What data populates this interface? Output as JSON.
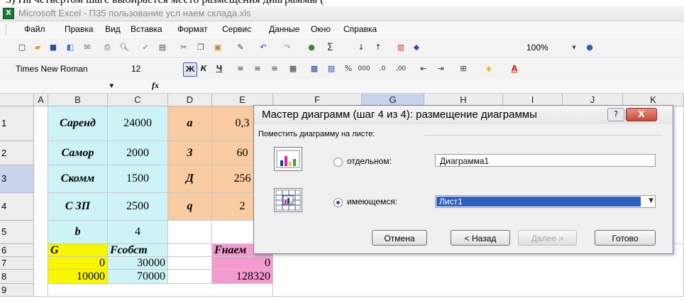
{
  "caption": "5)     На четвертом шаге выбирается место размещения диаграммы (",
  "window": {
    "title": "Microsoft Excel - П35 пользование усл наем склада.xls",
    "app_icon": "excel-icon"
  },
  "menu": [
    "Файл",
    "Правка",
    "Вид",
    "Вставка",
    "Формат",
    "Сервис",
    "Данные",
    "Окно",
    "Справка"
  ],
  "toolbar": {
    "zoom": "100%"
  },
  "format_bar": {
    "font": "Times New Roman",
    "size": "12"
  },
  "formula_bar": {
    "fx": "fx"
  },
  "columns": [
    "A",
    "B",
    "C",
    "D",
    "E",
    "F",
    "G",
    "H",
    "I",
    "J",
    "K"
  ],
  "rows": [
    "1",
    "2",
    "3",
    "4",
    "5",
    "6",
    "7",
    "8",
    "9"
  ],
  "cells": {
    "B1": "Саренд",
    "C1": "24000",
    "D1": "а",
    "E1": "0,3",
    "B2": "Самор",
    "C2": "2000",
    "D2": "З",
    "E2": "60",
    "B3": "Скомм",
    "C3": "1500",
    "D3": "Д",
    "E3": "256",
    "B4": "С ЗП",
    "C4": "2500",
    "D4": "q",
    "E4": "2",
    "B5": "b",
    "C5": "4",
    "B6": "G",
    "C6": "Fсобст",
    "E6": "Fнаем",
    "B7": "0",
    "C7": "30000",
    "E7": "0",
    "B8": "10000",
    "C8": "70000",
    "E8": "128320"
  },
  "dialog": {
    "title": "Мастер диаграмм (шаг 4 из 4): размещение диаграммы",
    "help": "?",
    "close": "X",
    "group_label": "Поместить диаграмму на листе:",
    "option1_label": "отдельном:",
    "option1_value": "Диаграмма1",
    "option2_label": "имеющемся:",
    "option2_value": "Лист1",
    "buttons": {
      "cancel": "Отмена",
      "back": "< Назад",
      "next": "Далее >",
      "finish": "Готово"
    }
  }
}
